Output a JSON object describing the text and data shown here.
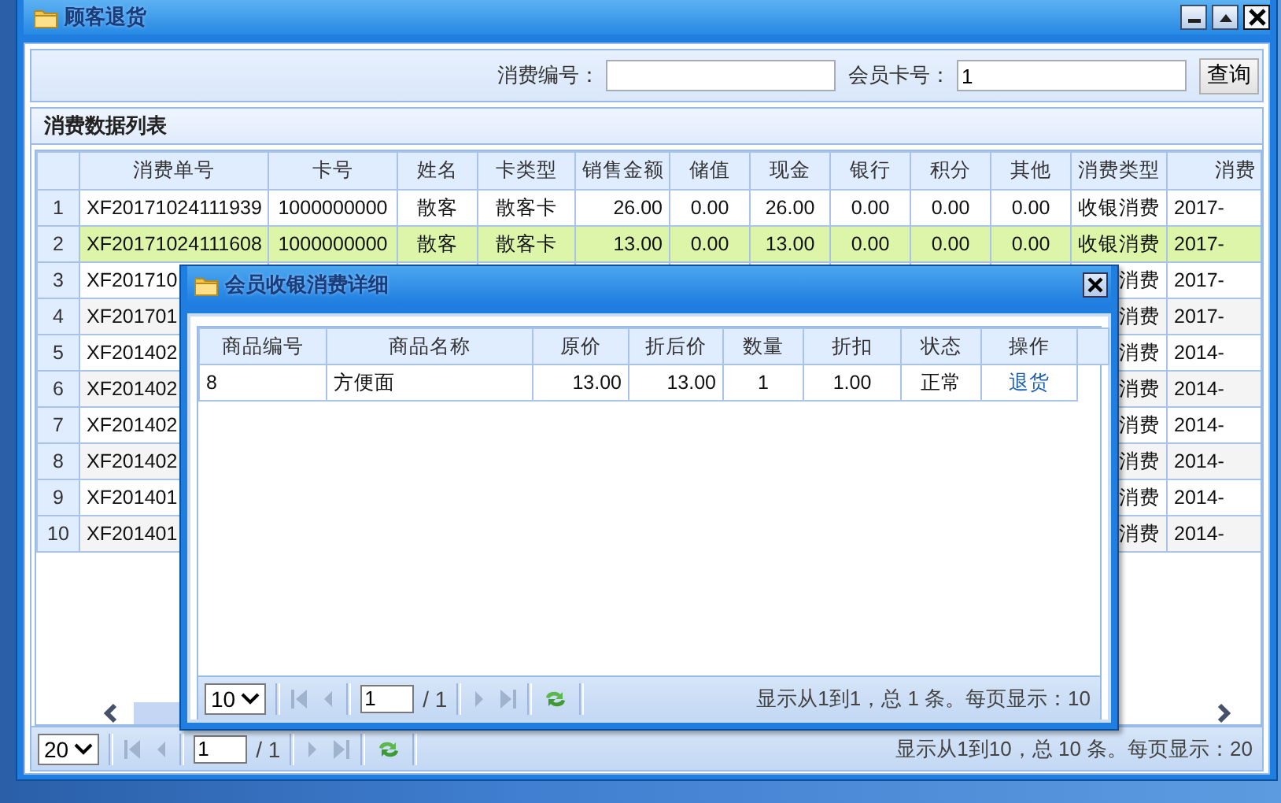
{
  "window": {
    "title": "顾客退货"
  },
  "search": {
    "fields": [
      {
        "label": "消费编号："
      },
      {
        "label": "会员卡号：",
        "value": "1"
      }
    ],
    "button": "查询"
  },
  "panel": {
    "title": "消费数据列表"
  },
  "table": {
    "columns": [
      "消费单号",
      "卡号",
      "姓名",
      "卡类型",
      "销售金额",
      "储值",
      "现金",
      "银行",
      "积分",
      "其他",
      "消费类型",
      "消费"
    ],
    "rows": [
      {
        "kind": "full",
        "num": "1",
        "selected": false,
        "cells": [
          "XF20171024111939",
          "1000000000",
          "散客",
          "散客卡",
          "26.00",
          "0.00",
          "26.00",
          "0.00",
          "0.00",
          "0.00",
          "收银消费",
          "2017-"
        ]
      },
      {
        "kind": "full",
        "num": "2",
        "selected": true,
        "cells": [
          "XF20171024111608",
          "1000000000",
          "散客",
          "散客卡",
          "13.00",
          "0.00",
          "13.00",
          "0.00",
          "0.00",
          "0.00",
          "收银消费",
          "2017-"
        ]
      },
      {
        "kind": "covered",
        "num": "3",
        "selected": false,
        "order_no": "XF201710",
        "type": "消费",
        "date": "2017-"
      },
      {
        "kind": "covered",
        "num": "4",
        "selected": false,
        "order_no": "XF201701",
        "type": "消费",
        "date": "2017-"
      },
      {
        "kind": "covered",
        "num": "5",
        "selected": false,
        "order_no": "XF201402",
        "type": "消费",
        "date": "2014-"
      },
      {
        "kind": "covered",
        "num": "6",
        "selected": false,
        "order_no": "XF201402",
        "type": "消费",
        "date": "2014-"
      },
      {
        "kind": "covered",
        "num": "7",
        "selected": false,
        "order_no": "XF201402",
        "type": "消费",
        "date": "2014-"
      },
      {
        "kind": "covered",
        "num": "8",
        "selected": false,
        "order_no": "XF201402",
        "type": "消费",
        "date": "2014-"
      },
      {
        "kind": "covered",
        "num": "9",
        "selected": false,
        "order_no": "XF201401",
        "type": "消费",
        "date": "2014-"
      },
      {
        "kind": "covered",
        "num": "10",
        "selected": false,
        "order_no": "XF201401",
        "type": "消费",
        "date": "2014-"
      }
    ]
  },
  "pager": {
    "page_size": "20",
    "page": "1",
    "pages": "/ 1",
    "summary": "显示从1到10，总 10 条。每页显示：20"
  },
  "dialog": {
    "title": "会员收银消费详细",
    "table": {
      "columns": [
        "商品编号",
        "商品名称",
        "原价",
        "折后价",
        "数量",
        "折扣",
        "状态",
        "操作"
      ],
      "rows": [
        {
          "selected": false,
          "cells": [
            "8",
            "方便面",
            "13.00",
            "13.00",
            "1",
            "1.00",
            "正常"
          ],
          "action": "退货"
        }
      ]
    },
    "pager": {
      "page_size": "10",
      "page": "1",
      "pages": "/ 1",
      "summary": "显示从1到1，总 1 条。每页显示：10"
    }
  }
}
